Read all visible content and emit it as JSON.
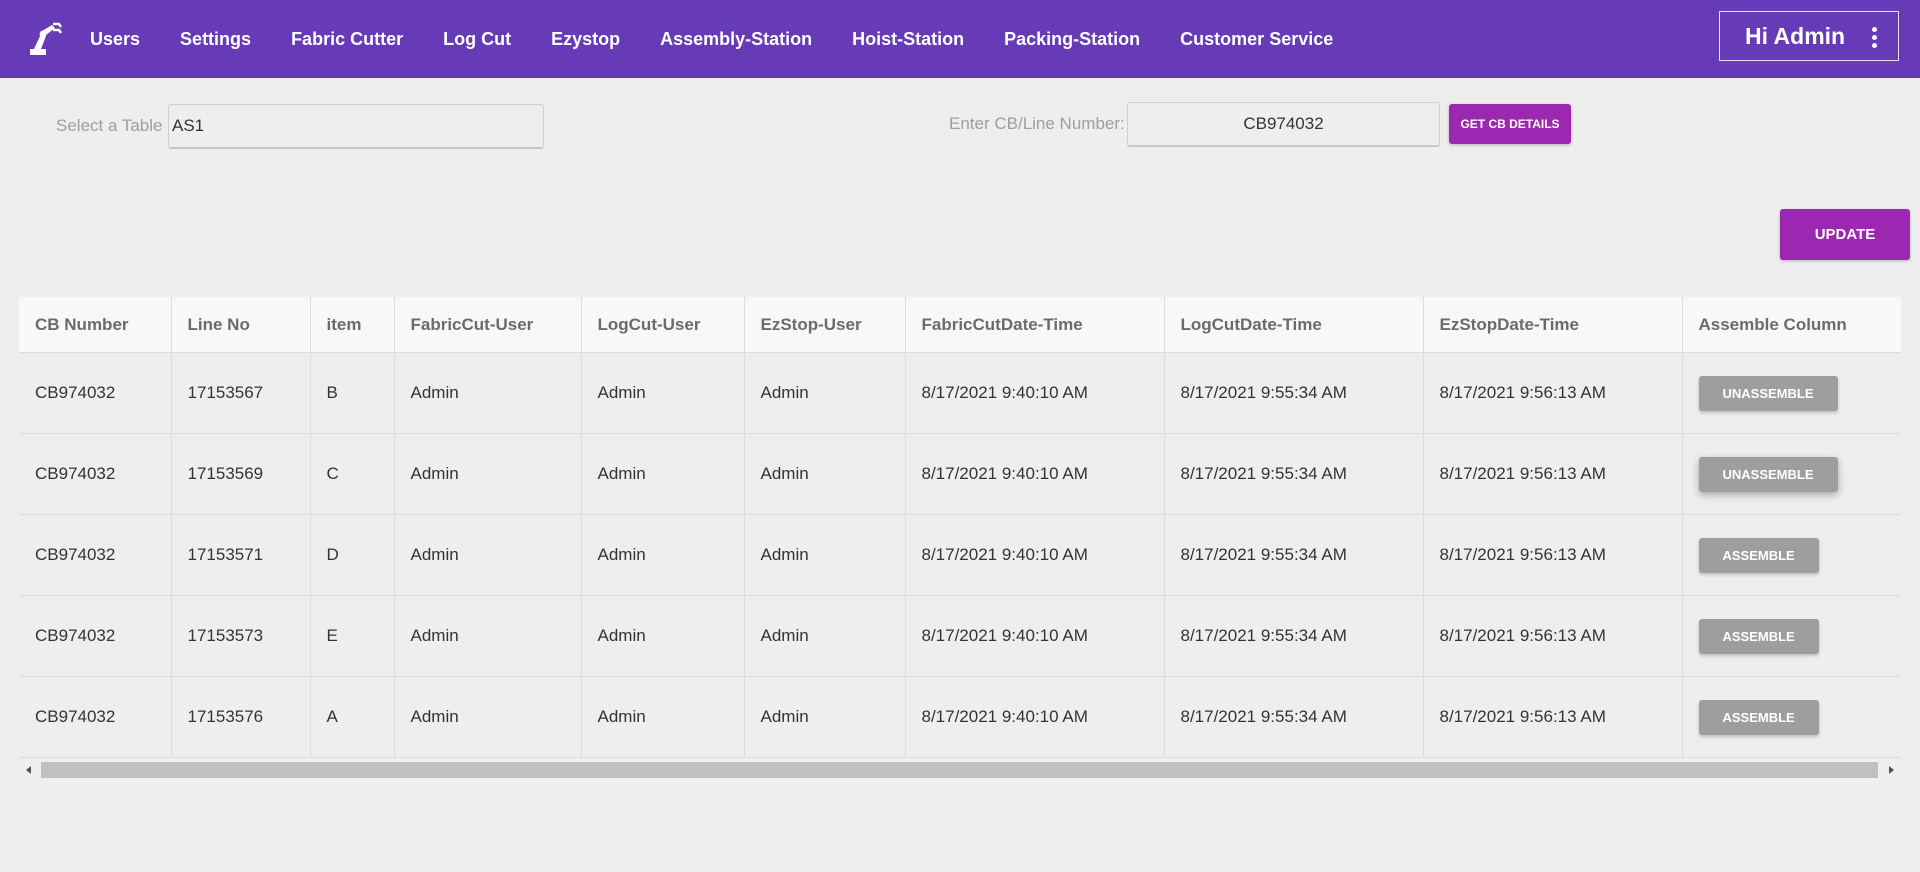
{
  "nav": {
    "logo_icon": "robot-arm-icon",
    "items": [
      "Users",
      "Settings",
      "Fabric Cutter",
      "Log Cut",
      "Ezystop",
      "Assembly-Station",
      "Hoist-Station",
      "Packing-Station",
      "Customer Service"
    ],
    "user_greeting": "Hi Admin",
    "menu_icon": "more-vertical-icon"
  },
  "filters": {
    "table_label": "Select a Table",
    "table_value": "AS1",
    "cb_label": "Enter CB/Line Number:",
    "cb_value": "CB974032",
    "get_details_label": "GET CB DETAILS"
  },
  "update_label": "UPDATE",
  "table": {
    "headers": [
      "CB Number",
      "Line No",
      "item",
      "FabricCut-User",
      "LogCut-User",
      "EzStop-User",
      "FabricCutDate-Time",
      "LogCutDate-Time",
      "EzStopDate-Time",
      "Assemble Column"
    ],
    "rows": [
      {
        "cb": "CB974032",
        "line": "17153567",
        "item": "B",
        "fabric_user": "Admin",
        "log_user": "Admin",
        "ez_user": "Admin",
        "fabric_dt": "8/17/2021 9:40:10 AM",
        "log_dt": "8/17/2021 9:55:34 AM",
        "ez_dt": "8/17/2021 9:56:13 AM",
        "action": "UNASSEMBLE"
      },
      {
        "cb": "CB974032",
        "line": "17153569",
        "item": "C",
        "fabric_user": "Admin",
        "log_user": "Admin",
        "ez_user": "Admin",
        "fabric_dt": "8/17/2021 9:40:10 AM",
        "log_dt": "8/17/2021 9:55:34 AM",
        "ez_dt": "8/17/2021 9:56:13 AM",
        "action": "UNASSEMBLE"
      },
      {
        "cb": "CB974032",
        "line": "17153571",
        "item": "D",
        "fabric_user": "Admin",
        "log_user": "Admin",
        "ez_user": "Admin",
        "fabric_dt": "8/17/2021 9:40:10 AM",
        "log_dt": "8/17/2021 9:55:34 AM",
        "ez_dt": "8/17/2021 9:56:13 AM",
        "action": "ASSEMBLE"
      },
      {
        "cb": "CB974032",
        "line": "17153573",
        "item": "E",
        "fabric_user": "Admin",
        "log_user": "Admin",
        "ez_user": "Admin",
        "fabric_dt": "8/17/2021 9:40:10 AM",
        "log_dt": "8/17/2021 9:55:34 AM",
        "ez_dt": "8/17/2021 9:56:13 AM",
        "action": "ASSEMBLE"
      },
      {
        "cb": "CB974032",
        "line": "17153576",
        "item": "A",
        "fabric_user": "Admin",
        "log_user": "Admin",
        "ez_user": "Admin",
        "fabric_dt": "8/17/2021 9:40:10 AM",
        "log_dt": "8/17/2021 9:55:34 AM",
        "ez_dt": "8/17/2021 9:56:13 AM",
        "action": "ASSEMBLE"
      }
    ]
  },
  "colors": {
    "nav_bg": "#673ab7",
    "primary_button": "#9c27b0",
    "action_button": "#9e9e9e",
    "page_bg": "#eeeeee"
  }
}
